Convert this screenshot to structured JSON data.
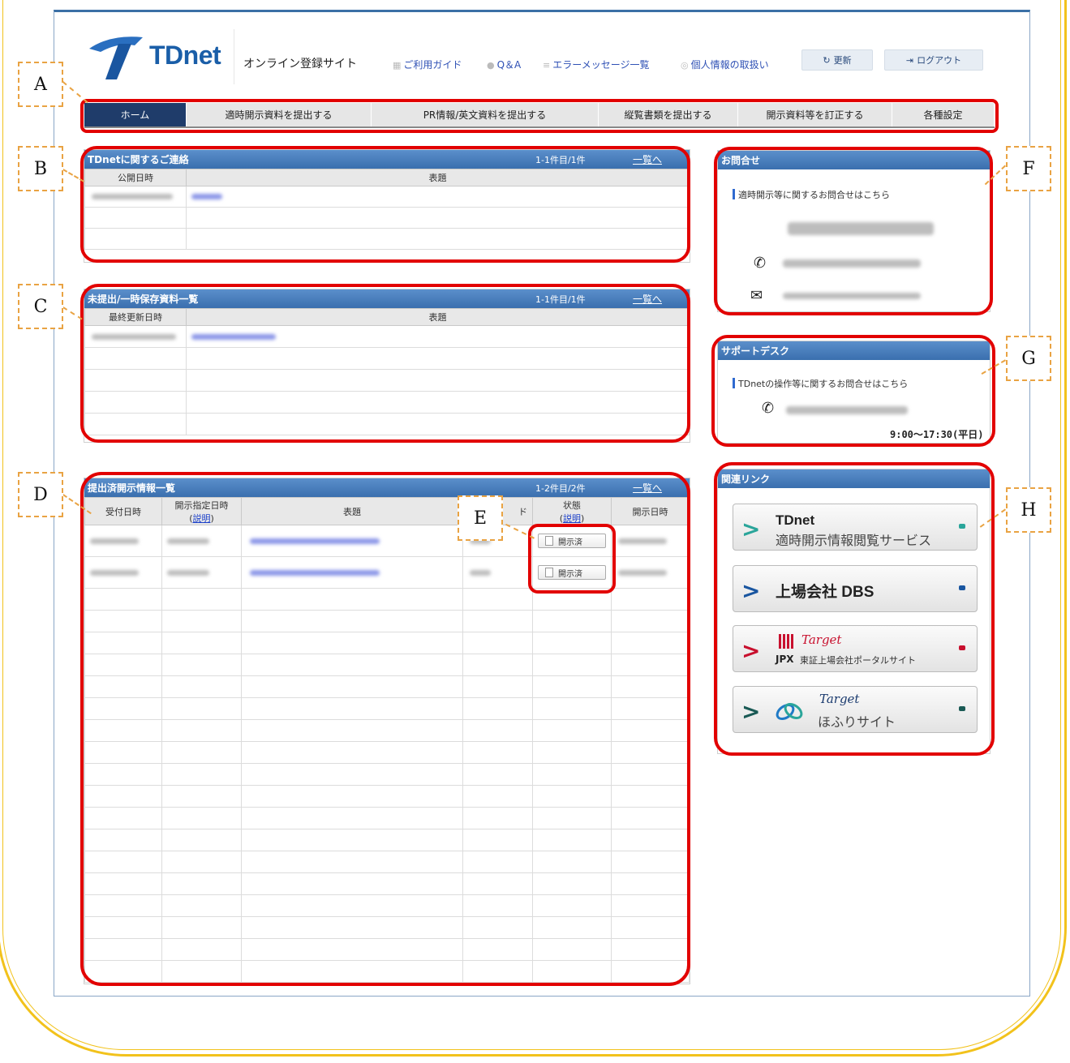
{
  "header": {
    "logo_text": "TDnet",
    "site_title": "オンライン登録サイト",
    "links": [
      "ご利用ガイド",
      "Q＆A",
      "エラーメッセージ一覧",
      "個人情報の取扱い"
    ],
    "refresh_label": "更新",
    "logout_label": "ログアウト"
  },
  "nav": {
    "tabs": [
      "ホーム",
      "適時開示資料を提出する",
      "PR情報/英文資料を提出する",
      "縦覧書類を提出する",
      "開示資料等を訂正する",
      "各種設定"
    ]
  },
  "contact_panel": {
    "title": "TDnetに関するご連絡",
    "count": "1-1件目/1件",
    "more": "一覧へ",
    "columns": [
      "公開日時",
      "表題"
    ]
  },
  "draft_panel": {
    "title": "未提出/一時保存資料一覧",
    "count": "1-1件目/1件",
    "more": "一覧へ",
    "columns": [
      "最終更新日時",
      "表題"
    ]
  },
  "submitted_panel": {
    "title": "提出済開示情報一覧",
    "count": "1-2件目/2件",
    "more": "一覧へ",
    "columns": [
      "受付日時",
      "開示指定日時",
      "表題",
      "ド",
      "状態",
      "開示日時"
    ],
    "help_link": "説明",
    "rows": [
      {
        "status": "開示済"
      },
      {
        "status": "開示済"
      }
    ]
  },
  "inquiry": {
    "title": "お問合せ",
    "label": "適時開示等に関するお問合せはこちら"
  },
  "support": {
    "title": "サポートデスク",
    "label": "TDnetの操作等に関するお問合せはこちら",
    "hours": "9:00〜17:30(平日)"
  },
  "links_panel": {
    "title": "関連リンク",
    "items": [
      {
        "title": "TDnet",
        "subtitle": "適時開示情報閲覧サービス"
      },
      {
        "title": "上場会社 DBS",
        "subtitle": ""
      },
      {
        "title": "Target",
        "subtitle": "東証上場会社ポータルサイト",
        "brand": "JPX"
      },
      {
        "title": "Target",
        "subtitle": "ほふりサイト"
      }
    ]
  },
  "callouts": [
    "A",
    "B",
    "C",
    "D",
    "E",
    "F",
    "G",
    "H"
  ],
  "colors": {
    "accent": "#3a6fae",
    "highlight": "#e20000",
    "callout_border": "#e9a343",
    "frame": "#f2c21b"
  }
}
